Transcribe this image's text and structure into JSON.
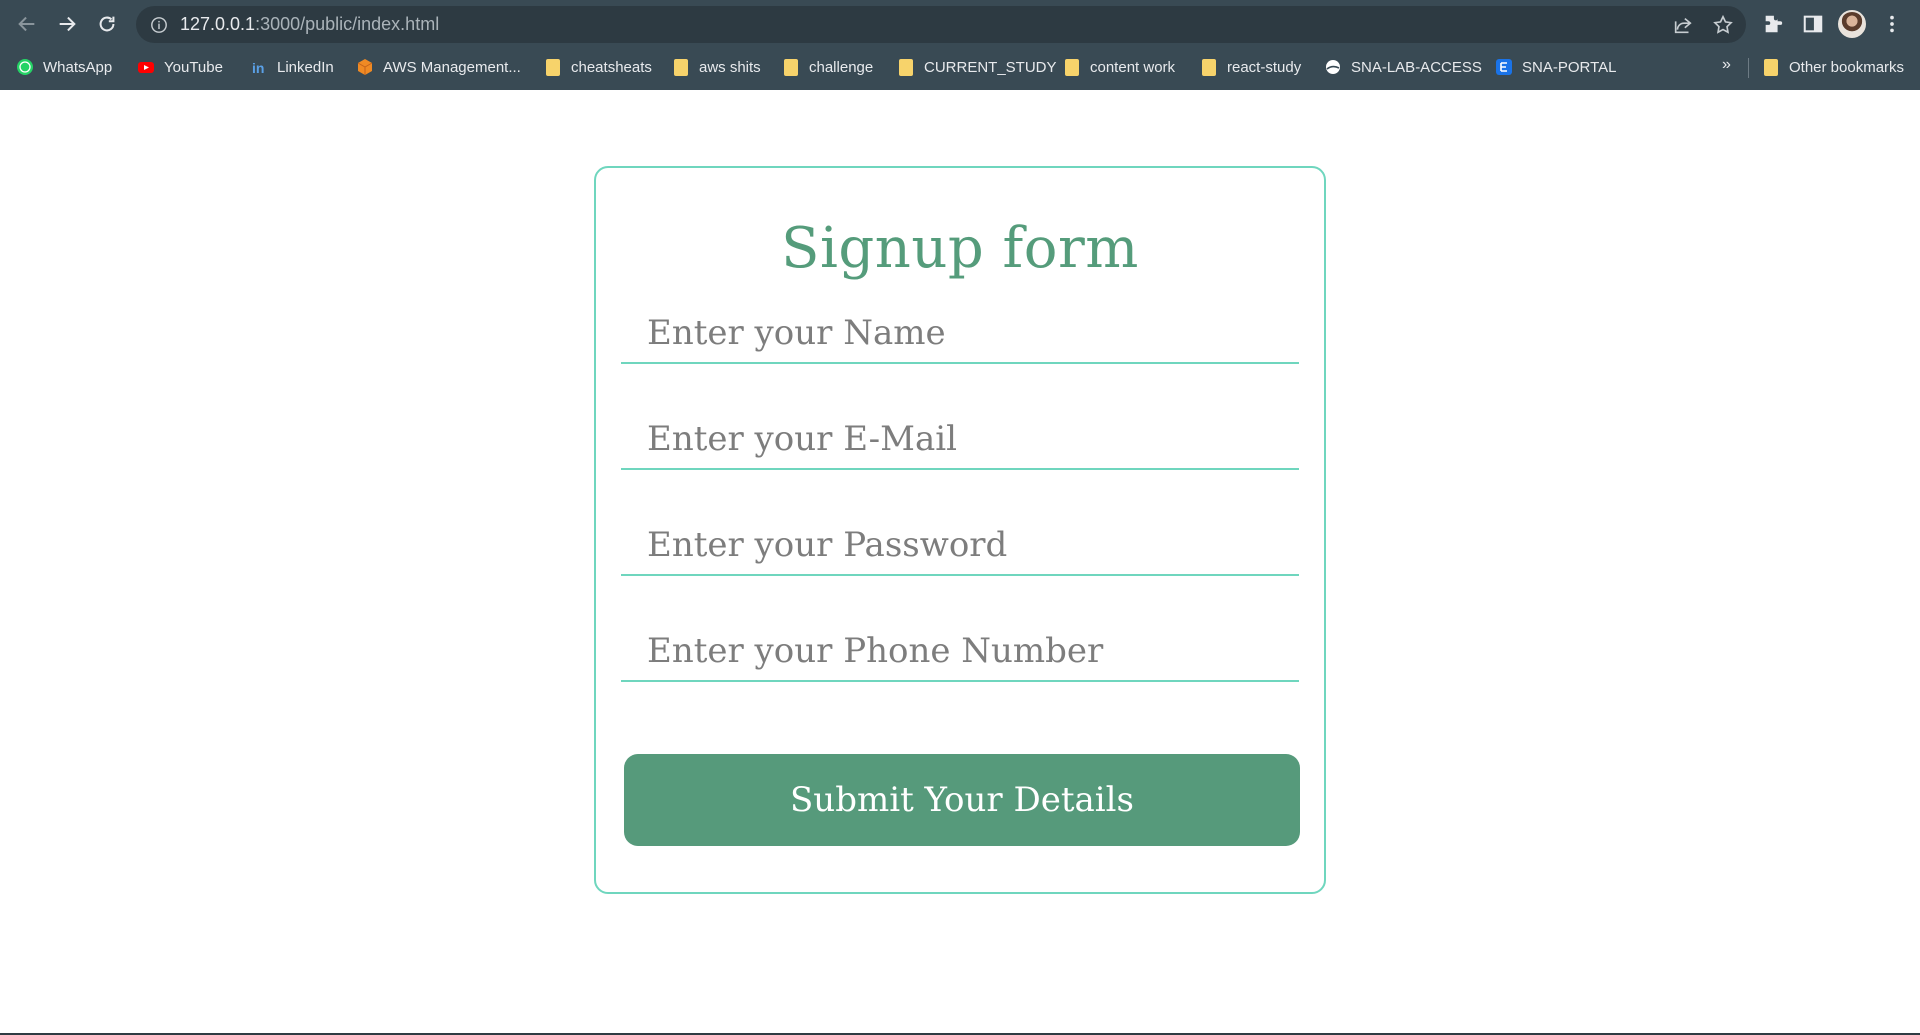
{
  "browser": {
    "url_host": "127.0.0.1",
    "url_rest": ":3000/public/index.html",
    "bookmarks": [
      {
        "label": "WhatsApp"
      },
      {
        "label": "YouTube"
      },
      {
        "label": "LinkedIn"
      },
      {
        "label": "AWS Management..."
      },
      {
        "label": "cheatsheats"
      },
      {
        "label": "aws shits"
      },
      {
        "label": "challenge"
      },
      {
        "label": "CURRENT_STUDY"
      },
      {
        "label": "content work"
      },
      {
        "label": "react-study"
      },
      {
        "label": "SNA-LAB-ACCESS"
      },
      {
        "label": "SNA-PORTAL"
      }
    ],
    "overflow_label": "»",
    "other_bookmarks": "Other bookmarks"
  },
  "form": {
    "title": "Signup form",
    "fields": [
      {
        "placeholder": "Enter your Name"
      },
      {
        "placeholder": "Enter your E-Mail"
      },
      {
        "placeholder": "Enter your Password"
      },
      {
        "placeholder": "Enter your Phone Number"
      }
    ],
    "submit_label": "Submit Your Details"
  },
  "colors": {
    "accent": "#6fd6be",
    "title": "#559c7b",
    "button": "#569a7b",
    "chrome": "#394a54"
  }
}
